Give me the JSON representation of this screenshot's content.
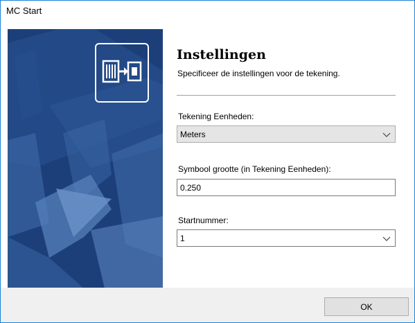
{
  "window": {
    "title": "MC Start"
  },
  "sidebar": {
    "accent_color": "#1c3f7a",
    "logo_icon": "device-arrow-icon"
  },
  "header": {
    "title": "Instellingen",
    "subtitle": "Specificeer de instellingen voor de tekening."
  },
  "form": {
    "units": {
      "label": "Tekening Eenheden:",
      "value": "Meters"
    },
    "symbol_size": {
      "label": "Symbool grootte (in Tekening Eenheden):",
      "value": "0.250"
    },
    "start_number": {
      "label": "Startnummer:",
      "value": "1"
    }
  },
  "footer": {
    "ok_label": "OK"
  }
}
